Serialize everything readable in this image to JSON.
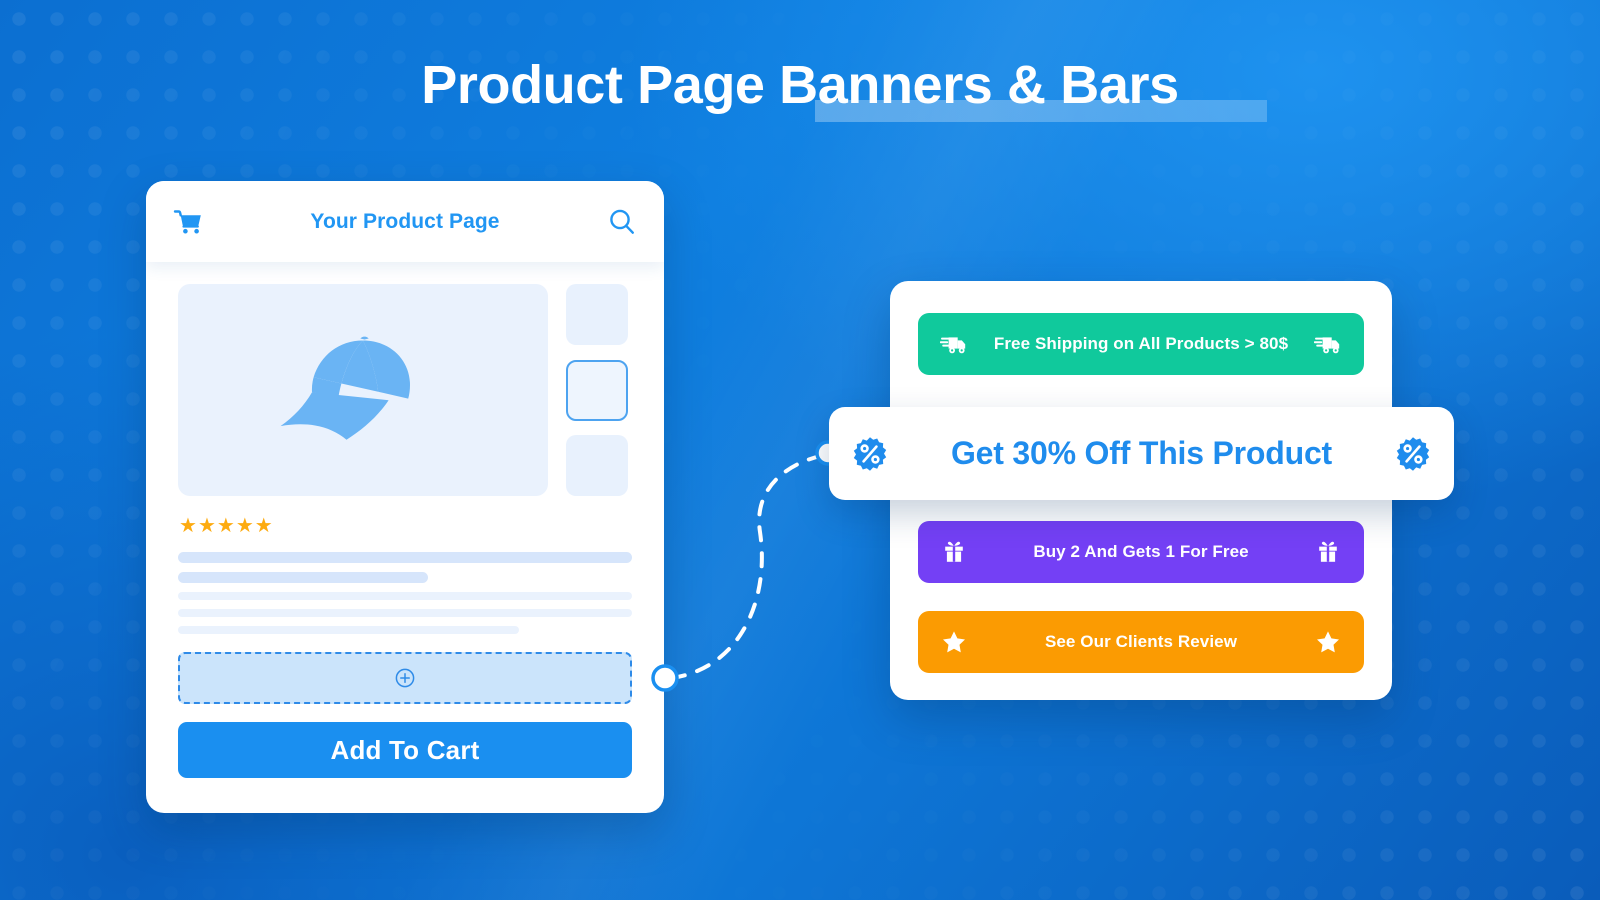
{
  "page": {
    "title": "Product Page Banners & Bars",
    "title_highlight": "Banners & Bars",
    "background_color": "#0f7fe0"
  },
  "product_card": {
    "header": {
      "cart_icon": "shopping-cart-icon",
      "title": "Your Product Page",
      "search_icon": "search-icon",
      "title_color": "#2196f3"
    },
    "gallery": {
      "hero_icon": "baseball-cap-icon",
      "hero_bg": "#eaf2fd",
      "thumbnails": [
        {
          "selected": false
        },
        {
          "selected": true
        },
        {
          "selected": false
        }
      ],
      "selected_border_color": "#4da3f0"
    },
    "rating": {
      "stars_filled": 5,
      "star_glyph": "★",
      "star_color": "#fdab10"
    },
    "placeholder_lines": [
      {
        "size": "big",
        "width": "w100"
      },
      {
        "size": "big",
        "width": "w55"
      },
      {
        "size": "sm",
        "width": "w100"
      },
      {
        "size": "sm",
        "width": "w100"
      },
      {
        "size": "sm",
        "width": "w75"
      }
    ],
    "dropzone": {
      "icon": "plus-circle-icon",
      "fill_color": "#cbe4fb",
      "border_color": "#2f8be8"
    },
    "add_to_cart": {
      "label": "Add To Cart",
      "color": "#1a8ff0"
    }
  },
  "banner_panel": {
    "bars": [
      {
        "label": "Free Shipping on All Products > 80$",
        "icon": "shipping-truck-icon",
        "color": "#10c99c"
      },
      {
        "label": "Buy 2 And Gets 1 For Free",
        "icon": "gift-icon",
        "color": "#7440f5"
      },
      {
        "label": "See Our Clients Review",
        "icon": "star-icon",
        "color": "#fb9b02"
      }
    ],
    "featured_bar": {
      "label": "Get 30% Off  This Product",
      "icon": "percent-badge-icon",
      "text_color": "#1f8ced",
      "background": "#ffffff"
    }
  },
  "connector": {
    "style": "dashed-curve",
    "color": "#ffffff",
    "endpoint_fill": "#ffffff",
    "endpoint_border": "#1a8ff0"
  }
}
